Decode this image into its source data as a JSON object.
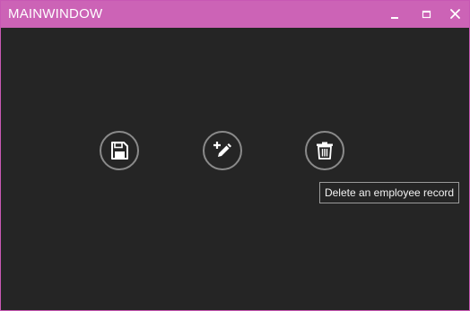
{
  "window": {
    "title": "MAINWINDOW",
    "titlebar_color": "#cc63b6",
    "background_color": "#252525",
    "controls": [
      {
        "name": "minimize",
        "icon": "minimize-icon"
      },
      {
        "name": "maximize",
        "icon": "maximize-icon"
      },
      {
        "name": "close",
        "icon": "close-icon"
      }
    ]
  },
  "toolbar": {
    "buttons": [
      {
        "name": "save",
        "icon": "floppy-disk-icon"
      },
      {
        "name": "add-edit",
        "icon": "plus-pencil-icon"
      },
      {
        "name": "delete",
        "icon": "trash-icon"
      }
    ]
  },
  "tooltip": {
    "text": "Delete an employee record"
  }
}
